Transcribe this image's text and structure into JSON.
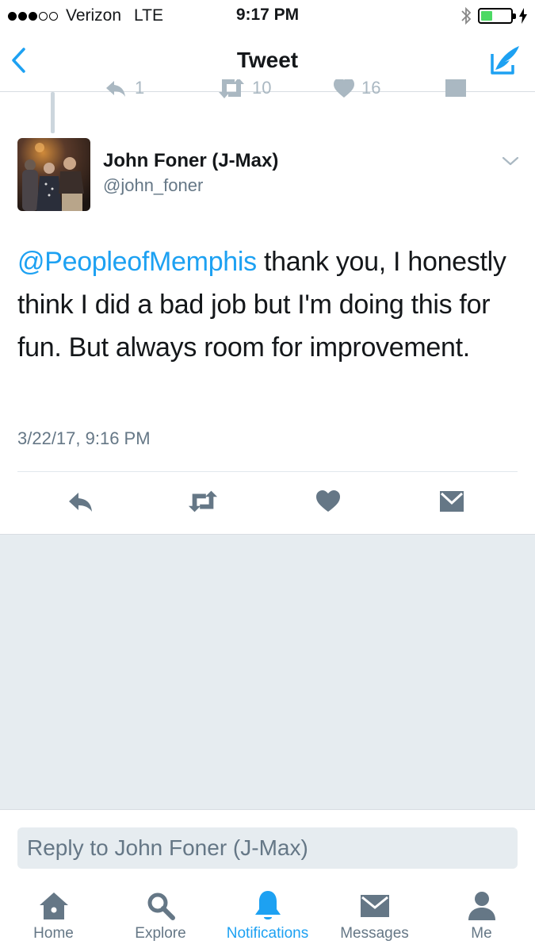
{
  "status_bar": {
    "carrier": "Verizon",
    "network": "LTE",
    "time": "9:17 PM"
  },
  "nav": {
    "title": "Tweet"
  },
  "tweet": {
    "author_name": "John Foner (J-Max)",
    "author_handle": "@john_foner",
    "mention": "@PeopleofMemphis",
    "text": " thank you, I honestly think I did a bad job but I'm doing this for fun. But always room for improvement.",
    "timestamp": "3/22/17, 9:16 PM"
  },
  "previous_tweet_actions": {
    "reply_count": "1",
    "retweet_count": "10",
    "like_count": "16"
  },
  "reply": {
    "placeholder": "Reply to John Foner (J-Max)"
  },
  "tabs": [
    {
      "label": "Home",
      "icon": "home-icon"
    },
    {
      "label": "Explore",
      "icon": "search-icon"
    },
    {
      "label": "Notifications",
      "icon": "bell-icon"
    },
    {
      "label": "Messages",
      "icon": "envelope-icon"
    },
    {
      "label": "Me",
      "icon": "person-icon"
    }
  ],
  "colors": {
    "accent": "#1da1f2",
    "icon_gray": "#657786",
    "background_gray": "#e6ecf0"
  }
}
